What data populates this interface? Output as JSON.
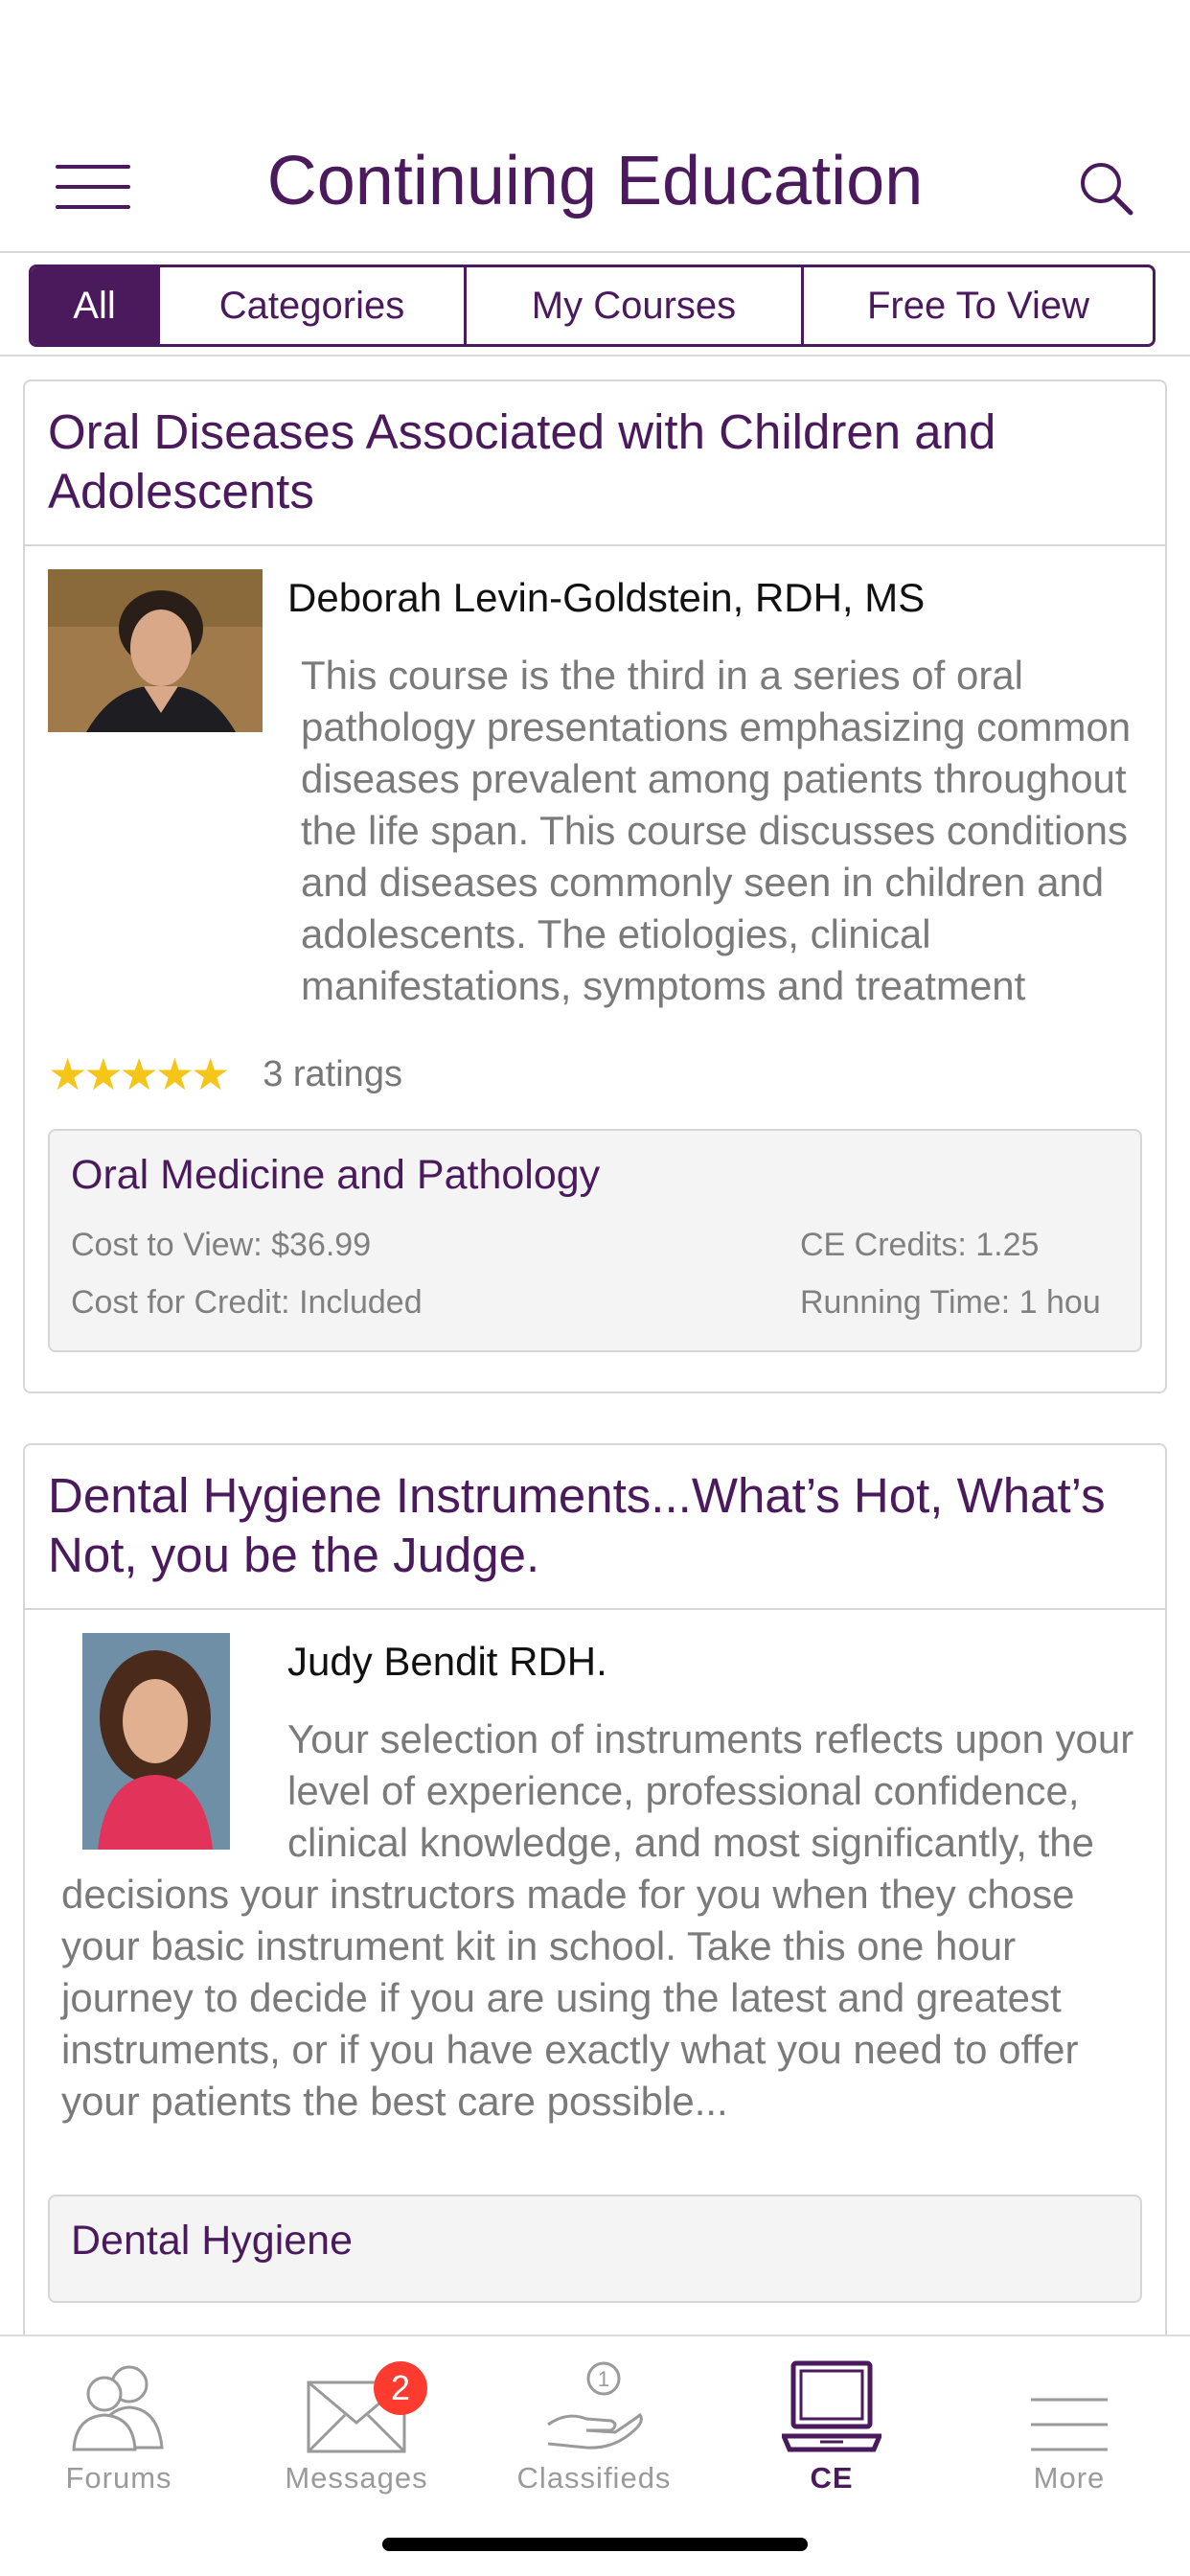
{
  "header": {
    "title": "Continuing Education"
  },
  "tabs": [
    {
      "label": "All",
      "active": true
    },
    {
      "label": "Categories",
      "active": false
    },
    {
      "label": "My Courses",
      "active": false
    },
    {
      "label": "Free To View",
      "active": false
    }
  ],
  "courses": [
    {
      "title": "Oral Diseases Associated with Children and Adolescents",
      "author": "Deborah Levin-Goldstein, RDH, MS",
      "description": "This course is the third in a series of oral pathology presentations emphasizing common diseases prevalent among patients throughout the life span. This course discusses conditions and diseases commonly seen in children and adolescents. The etiologies, clinical manifestations, symptoms and treatment options for",
      "stars": "★★★★★",
      "rating_value": 5,
      "ratings": "3 ratings",
      "category": "Oral Medicine and Pathology",
      "cost_to_view": "Cost to View: $36.99",
      "ce_credits": "CE Credits: 1.25",
      "cost_for_credit": "Cost for Credit: Included",
      "running_time": "Running Time: 1 hou"
    },
    {
      "title": "Dental Hygiene Instruments...What’s Hot, What’s Not, you be the Judge.",
      "author": "Judy Bendit RDH.",
      "description": "Your selection of instruments reflects upon your level of experience, professional confidence, clinical knowledge, and most significantly, the decisions your instructors made for you when they chose your basic instrument kit in school. Take this one hour journey to decide if you are using the latest and greatest instruments, or if you have exactly what you need to offer your patients the best care possible...",
      "category": "Dental Hygiene"
    }
  ],
  "bottom_nav": [
    {
      "label": "Forums",
      "icon": "people-icon"
    },
    {
      "label": "Messages",
      "icon": "envelope-icon",
      "badge": "2"
    },
    {
      "label": "Classifieds",
      "icon": "hand-coin-icon"
    },
    {
      "label": "CE",
      "icon": "laptop-icon",
      "active": true
    },
    {
      "label": "More",
      "icon": "more-lines-icon"
    }
  ],
  "colors": {
    "brand": "#4a1a5c",
    "star": "#f5c518",
    "badge": "#ff3b30"
  }
}
